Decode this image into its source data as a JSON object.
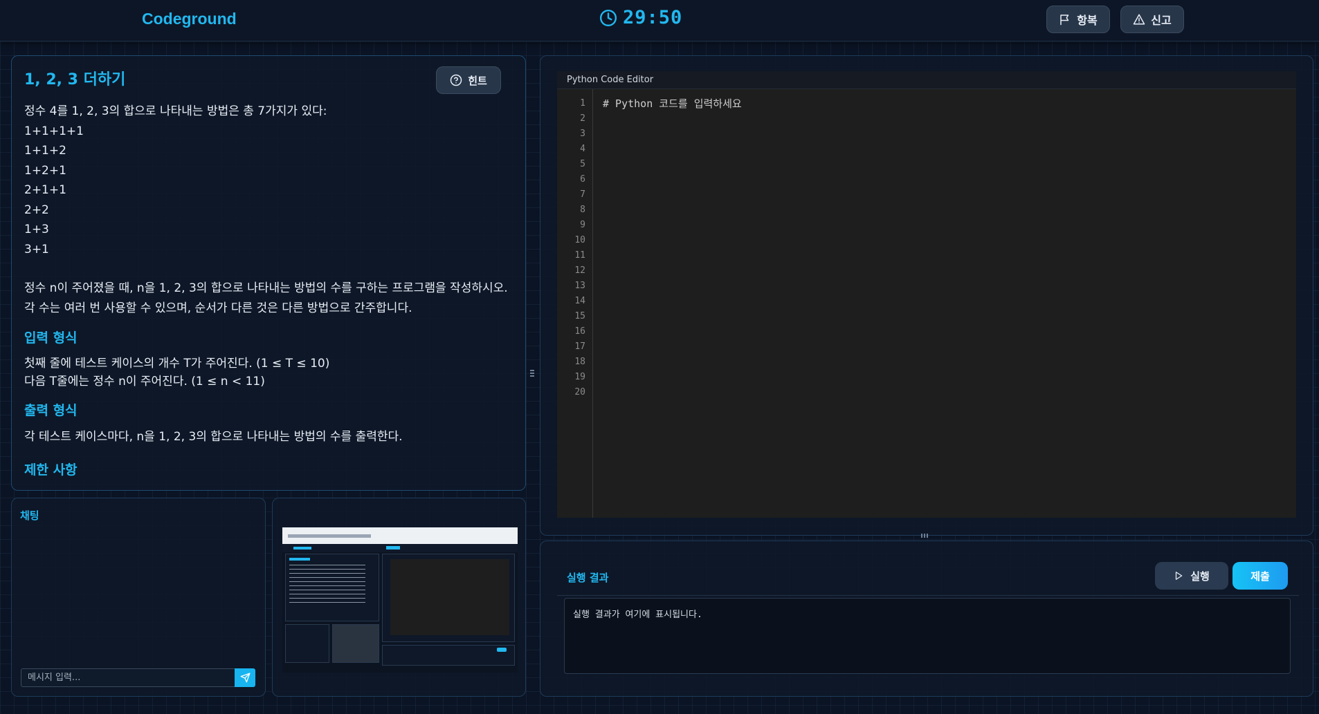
{
  "header": {
    "logo": "Codeground",
    "timer": "29:50",
    "surrender_label": "항복",
    "report_label": "신고"
  },
  "problem": {
    "title": "1, 2, 3 더하기",
    "hint_label": "힌트",
    "intro": "정수 4를 1, 2, 3의 합으로 나타내는 방법은 총 7가지가 있다:",
    "examples": [
      "1+1+1+1",
      "1+1+2",
      "1+2+1",
      "2+1+1",
      "2+2",
      "1+3",
      "3+1"
    ],
    "description": [
      "정수 n이 주어졌을 때, n을 1, 2, 3의 합으로 나타내는 방법의 수를 구하는 프로그램을 작성하시오.",
      "각 수는 여러 번 사용할 수 있으며, 순서가 다른 것은 다른 방법으로 간주합니다."
    ],
    "input_heading": "입력 형식",
    "input_lines": [
      "첫째 줄에 테스트 케이스의 개수 T가 주어진다. (1 ≤ T ≤ 10)",
      "다음 T줄에는 정수 n이 주어진다. (1 ≤ n < 11)"
    ],
    "output_heading": "출력 형식",
    "output_line": "각 테스트 케이스마다, n을 1, 2, 3의 합으로 나타내는 방법의 수를 출력한다.",
    "next_heading": "제한 사항"
  },
  "chat": {
    "title": "채팅",
    "placeholder": "메시지 입력..."
  },
  "editor": {
    "title": "Python Code Editor",
    "code": "# Python 코드를 입력하세요",
    "line_numbers": [
      "1",
      "2",
      "3",
      "4",
      "5",
      "6",
      "7",
      "8",
      "9",
      "10",
      "11",
      "12",
      "13",
      "14",
      "15",
      "16",
      "17",
      "18",
      "19",
      "20"
    ]
  },
  "result": {
    "title": "실행 결과",
    "run_label": "실행",
    "submit_label": "제출",
    "output": "실행 결과가 여기에 표시됩니다."
  },
  "colors": {
    "accent": "#22b8f0",
    "background": "#0b1424",
    "editor_bg": "#1e1e1e"
  },
  "icons": [
    "clock-icon",
    "flag-icon",
    "warning-icon",
    "help-circle-icon",
    "send-icon",
    "play-icon"
  ]
}
